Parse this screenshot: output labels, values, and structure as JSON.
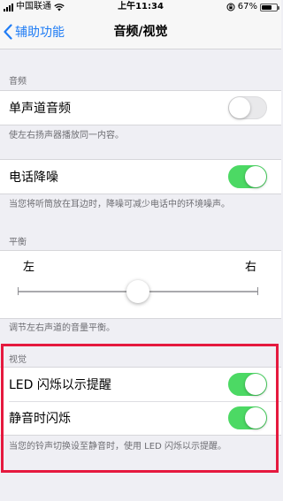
{
  "status_bar": {
    "carrier": "中国联通",
    "time": "上午11:34",
    "battery_pct": "67%",
    "battery_level": 0.67
  },
  "nav": {
    "back_label": "辅助功能",
    "title": "音频/视觉"
  },
  "audio": {
    "header": "音频",
    "mono_label": "单声道音频",
    "mono_on": false,
    "mono_footer": "使左右扬声器播放同一内容。",
    "noise_label": "电话降噪",
    "noise_on": true,
    "noise_footer": "当您将听筒放在耳边时，降噪可减少电话中的环境噪声。"
  },
  "balance": {
    "header": "平衡",
    "left_label": "左",
    "right_label": "右",
    "value": 0.5,
    "footer": "调节左右声道的音量平衡。"
  },
  "visual": {
    "header": "视觉",
    "led_label": "LED 闪烁以示提醒",
    "led_on": true,
    "silent_label": "静音时闪烁",
    "silent_on": true,
    "footer": "当您的铃声切换设至静音时，使用 LED 闪烁以示提醒。"
  },
  "colors": {
    "accent": "#1f7cf5",
    "toggle_on": "#4cd964",
    "highlight": "#e5193e"
  }
}
